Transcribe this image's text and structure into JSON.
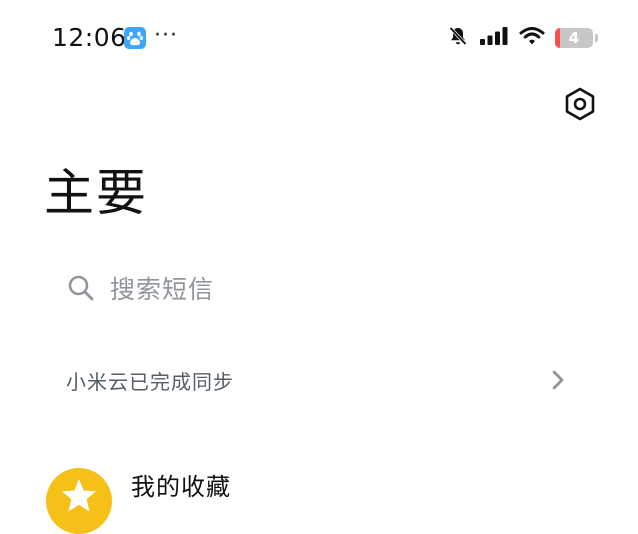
{
  "status_bar": {
    "time": "12:06",
    "more": "···",
    "battery_level": "4",
    "icons": [
      "baidu-app-icon",
      "silent-bell-icon",
      "signal-icon",
      "wifi-icon",
      "battery-icon"
    ]
  },
  "header": {
    "title": "主要",
    "settings_icon": "settings-hexagon-icon"
  },
  "search": {
    "placeholder": "搜索短信"
  },
  "sync": {
    "label": "小米云已完成同步"
  },
  "conversations": [
    {
      "title": "我的收藏",
      "avatar_icon": "star-icon",
      "avatar_color": "#f5c017"
    }
  ],
  "colors": {
    "background": "#ffffff",
    "secondary_text": "#8f959b",
    "battery_fill": "#c7c7c7",
    "battery_low": "#ff4d4d",
    "favorite_accent": "#f5c017"
  }
}
